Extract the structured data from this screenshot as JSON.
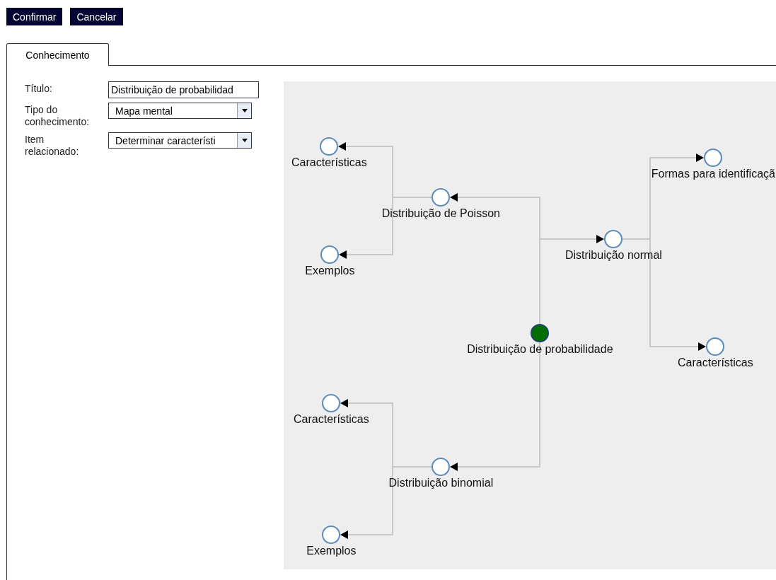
{
  "buttons": [
    {
      "label": "Confirmar"
    },
    {
      "label": "Cancelar"
    }
  ],
  "tabs": [
    {
      "label": "Conhecimento",
      "selected": true
    }
  ],
  "form": {
    "fields": [
      {
        "kind": "text",
        "label": "Título:",
        "value": "Distribuição de probabilidad"
      },
      {
        "kind": "select",
        "label": "Tipo do conhecimento:",
        "value": "Mapa mental"
      },
      {
        "kind": "select",
        "label": "Item relacionado:",
        "value": "Determinar característi"
      }
    ]
  },
  "mind_map": {
    "root": {
      "label": "Distribuição de probabilidade",
      "selected": true,
      "children": [
        {
          "label": "Distribuição de Poisson",
          "selected": false,
          "children": [
            {
              "label": "Características",
              "selected": false
            },
            {
              "label": "Exemplos",
              "selected": false
            }
          ]
        },
        {
          "label": "Distribuição binomial",
          "selected": false,
          "children": [
            {
              "label": "Características",
              "selected": false
            },
            {
              "label": "Exemplos",
              "selected": false
            }
          ]
        },
        {
          "label": "Distribuição normal",
          "selected": false,
          "children": [
            {
              "label": "Formas para identificaçã",
              "selected": false
            },
            {
              "label": "Características",
              "selected": false
            }
          ]
        }
      ]
    }
  }
}
